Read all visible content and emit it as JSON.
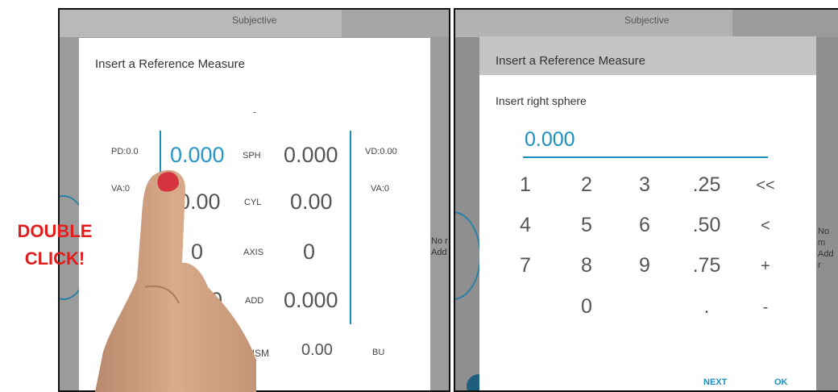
{
  "left": {
    "header_title": "Subjective",
    "dialog_title": "Insert a Reference Measure",
    "dash": "-",
    "pd": "PD:0.0",
    "vd": "VD:0.00",
    "va_left": "VA:0",
    "va_right": "VA:0",
    "rows": [
      {
        "label": "SPH",
        "right_value": "0.000",
        "left_value": "0.000"
      },
      {
        "label": "CYL",
        "right_value": "0.00",
        "left_value": "0.00"
      },
      {
        "label": "AXIS",
        "right_value": "0",
        "left_value": "0"
      },
      {
        "label": "ADD",
        "right_value": "0.000",
        "left_value": "00"
      },
      {
        "label": "PRISM",
        "right_value": "0.00"
      }
    ],
    "prism_base": "BU",
    "side_text_1": "No r",
    "side_text_2": "Add"
  },
  "annotation": {
    "line1": "DOUBLE",
    "line2": "CLICK!"
  },
  "right": {
    "header_title": "Subjective",
    "dialog_title": "Insert a Reference Measure",
    "panel_label": "Insert right sphere",
    "entry_value": "0.000",
    "keys": [
      [
        "1",
        "2",
        "3",
        ".25",
        "<<"
      ],
      [
        "4",
        "5",
        "6",
        ".50",
        "<"
      ],
      [
        "7",
        "8",
        "9",
        ".75",
        "+"
      ],
      [
        "",
        "0",
        "",
        ".",
        "-"
      ]
    ],
    "next_label": "NEXT",
    "ok_label": "OK",
    "side_text_1": "No m",
    "side_text_2": "Add r"
  },
  "colors": {
    "accent": "#1b8fbf",
    "annotation": "#e11d1d"
  }
}
